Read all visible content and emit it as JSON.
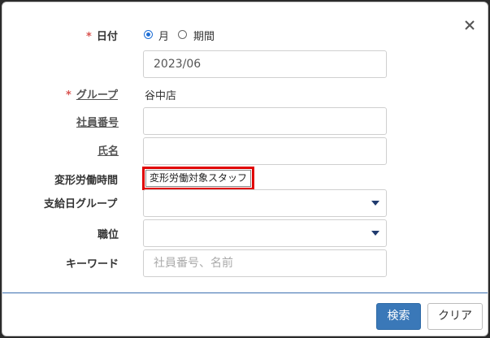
{
  "dialog": {
    "close_glyph": "×"
  },
  "form": {
    "date": {
      "label": "日付",
      "required_mark": "*",
      "option_month": "月",
      "option_period": "期間",
      "selected": "月",
      "value": "2023/06"
    },
    "group": {
      "label": "グループ",
      "required_mark": "*",
      "value": "谷中店"
    },
    "employee_number": {
      "label": "社員番号",
      "value": ""
    },
    "name": {
      "label": "氏名",
      "value": ""
    },
    "variable_working_hours": {
      "label": "変形労働時間",
      "value": "変形労働対象スタッフ"
    },
    "payday_group": {
      "label": "支給日グループ",
      "value": ""
    },
    "position": {
      "label": "職位",
      "value": ""
    },
    "keyword": {
      "label": "キーワード",
      "placeholder": "社員番号、名前"
    }
  },
  "buttons": {
    "search": "検索",
    "clear": "クリア"
  },
  "colors": {
    "primary": "#3a78b8",
    "required": "#d9534f",
    "highlight_border": "#e00000",
    "footer_line": "#3a6fb0"
  }
}
